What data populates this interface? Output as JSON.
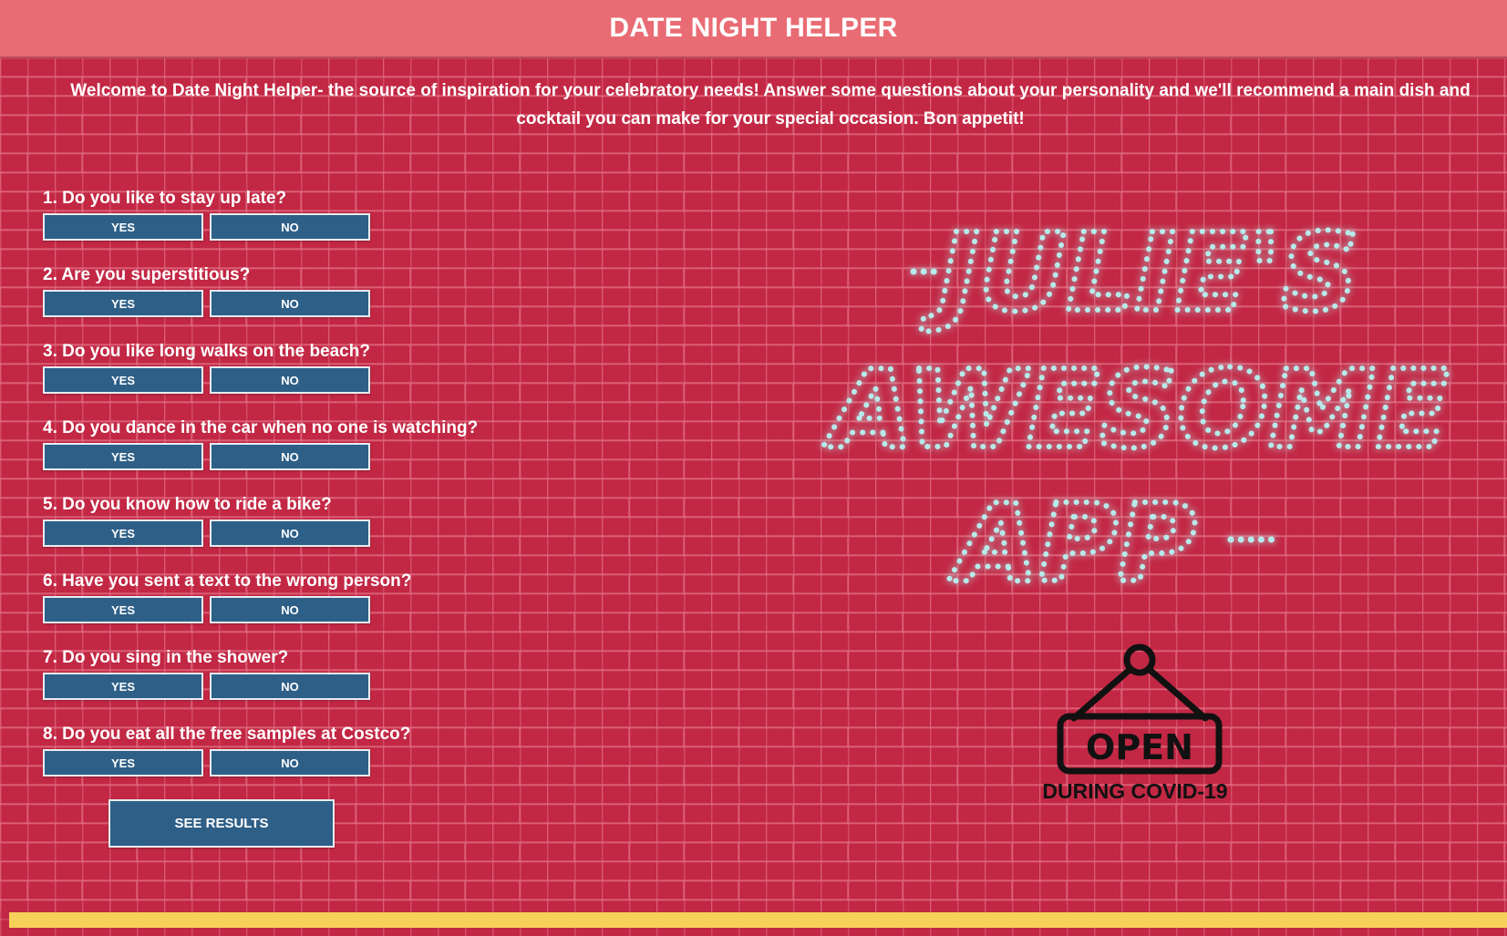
{
  "header": {
    "title": "DATE NIGHT HELPER"
  },
  "intro": "Welcome to Date Night Helper- the source of inspiration for your celebratory needs! Answer some questions about your personality and we'll recommend a main dish and cocktail you can make for your special occasion. Bon appetit!",
  "questions": [
    {
      "text": "1. Do you like to stay up late?",
      "yes": "YES",
      "no": "NO"
    },
    {
      "text": "2. Are you superstitious?",
      "yes": "YES",
      "no": "NO"
    },
    {
      "text": "3. Do you like long walks on the beach?",
      "yes": "YES",
      "no": "NO"
    },
    {
      "text": "4. Do you dance in the car when no one is watching?",
      "yes": "YES",
      "no": "NO"
    },
    {
      "text": "5. Do you know how to ride a bike?",
      "yes": "YES",
      "no": "NO"
    },
    {
      "text": "6. Have you sent a text to the wrong person?",
      "yes": "YES",
      "no": "NO"
    },
    {
      "text": "7. Do you sing in the shower?",
      "yes": "YES",
      "no": "NO"
    },
    {
      "text": "8. Do you eat all the free samples at Costco?",
      "yes": "YES",
      "no": "NO"
    }
  ],
  "see_results_label": "SEE RESULTS",
  "neon_sign": {
    "line1": "JULIE'S",
    "line2": "AWESOME",
    "line3": "APP",
    "color": "#9fdede"
  },
  "open_sign": {
    "label": "OPEN",
    "caption": "DURING COVID-19"
  },
  "colors": {
    "header_bg": "#e96c74",
    "brick_bg": "#c22744",
    "button_bg": "#2e5f87",
    "footer_bar": "#f7d05a"
  }
}
